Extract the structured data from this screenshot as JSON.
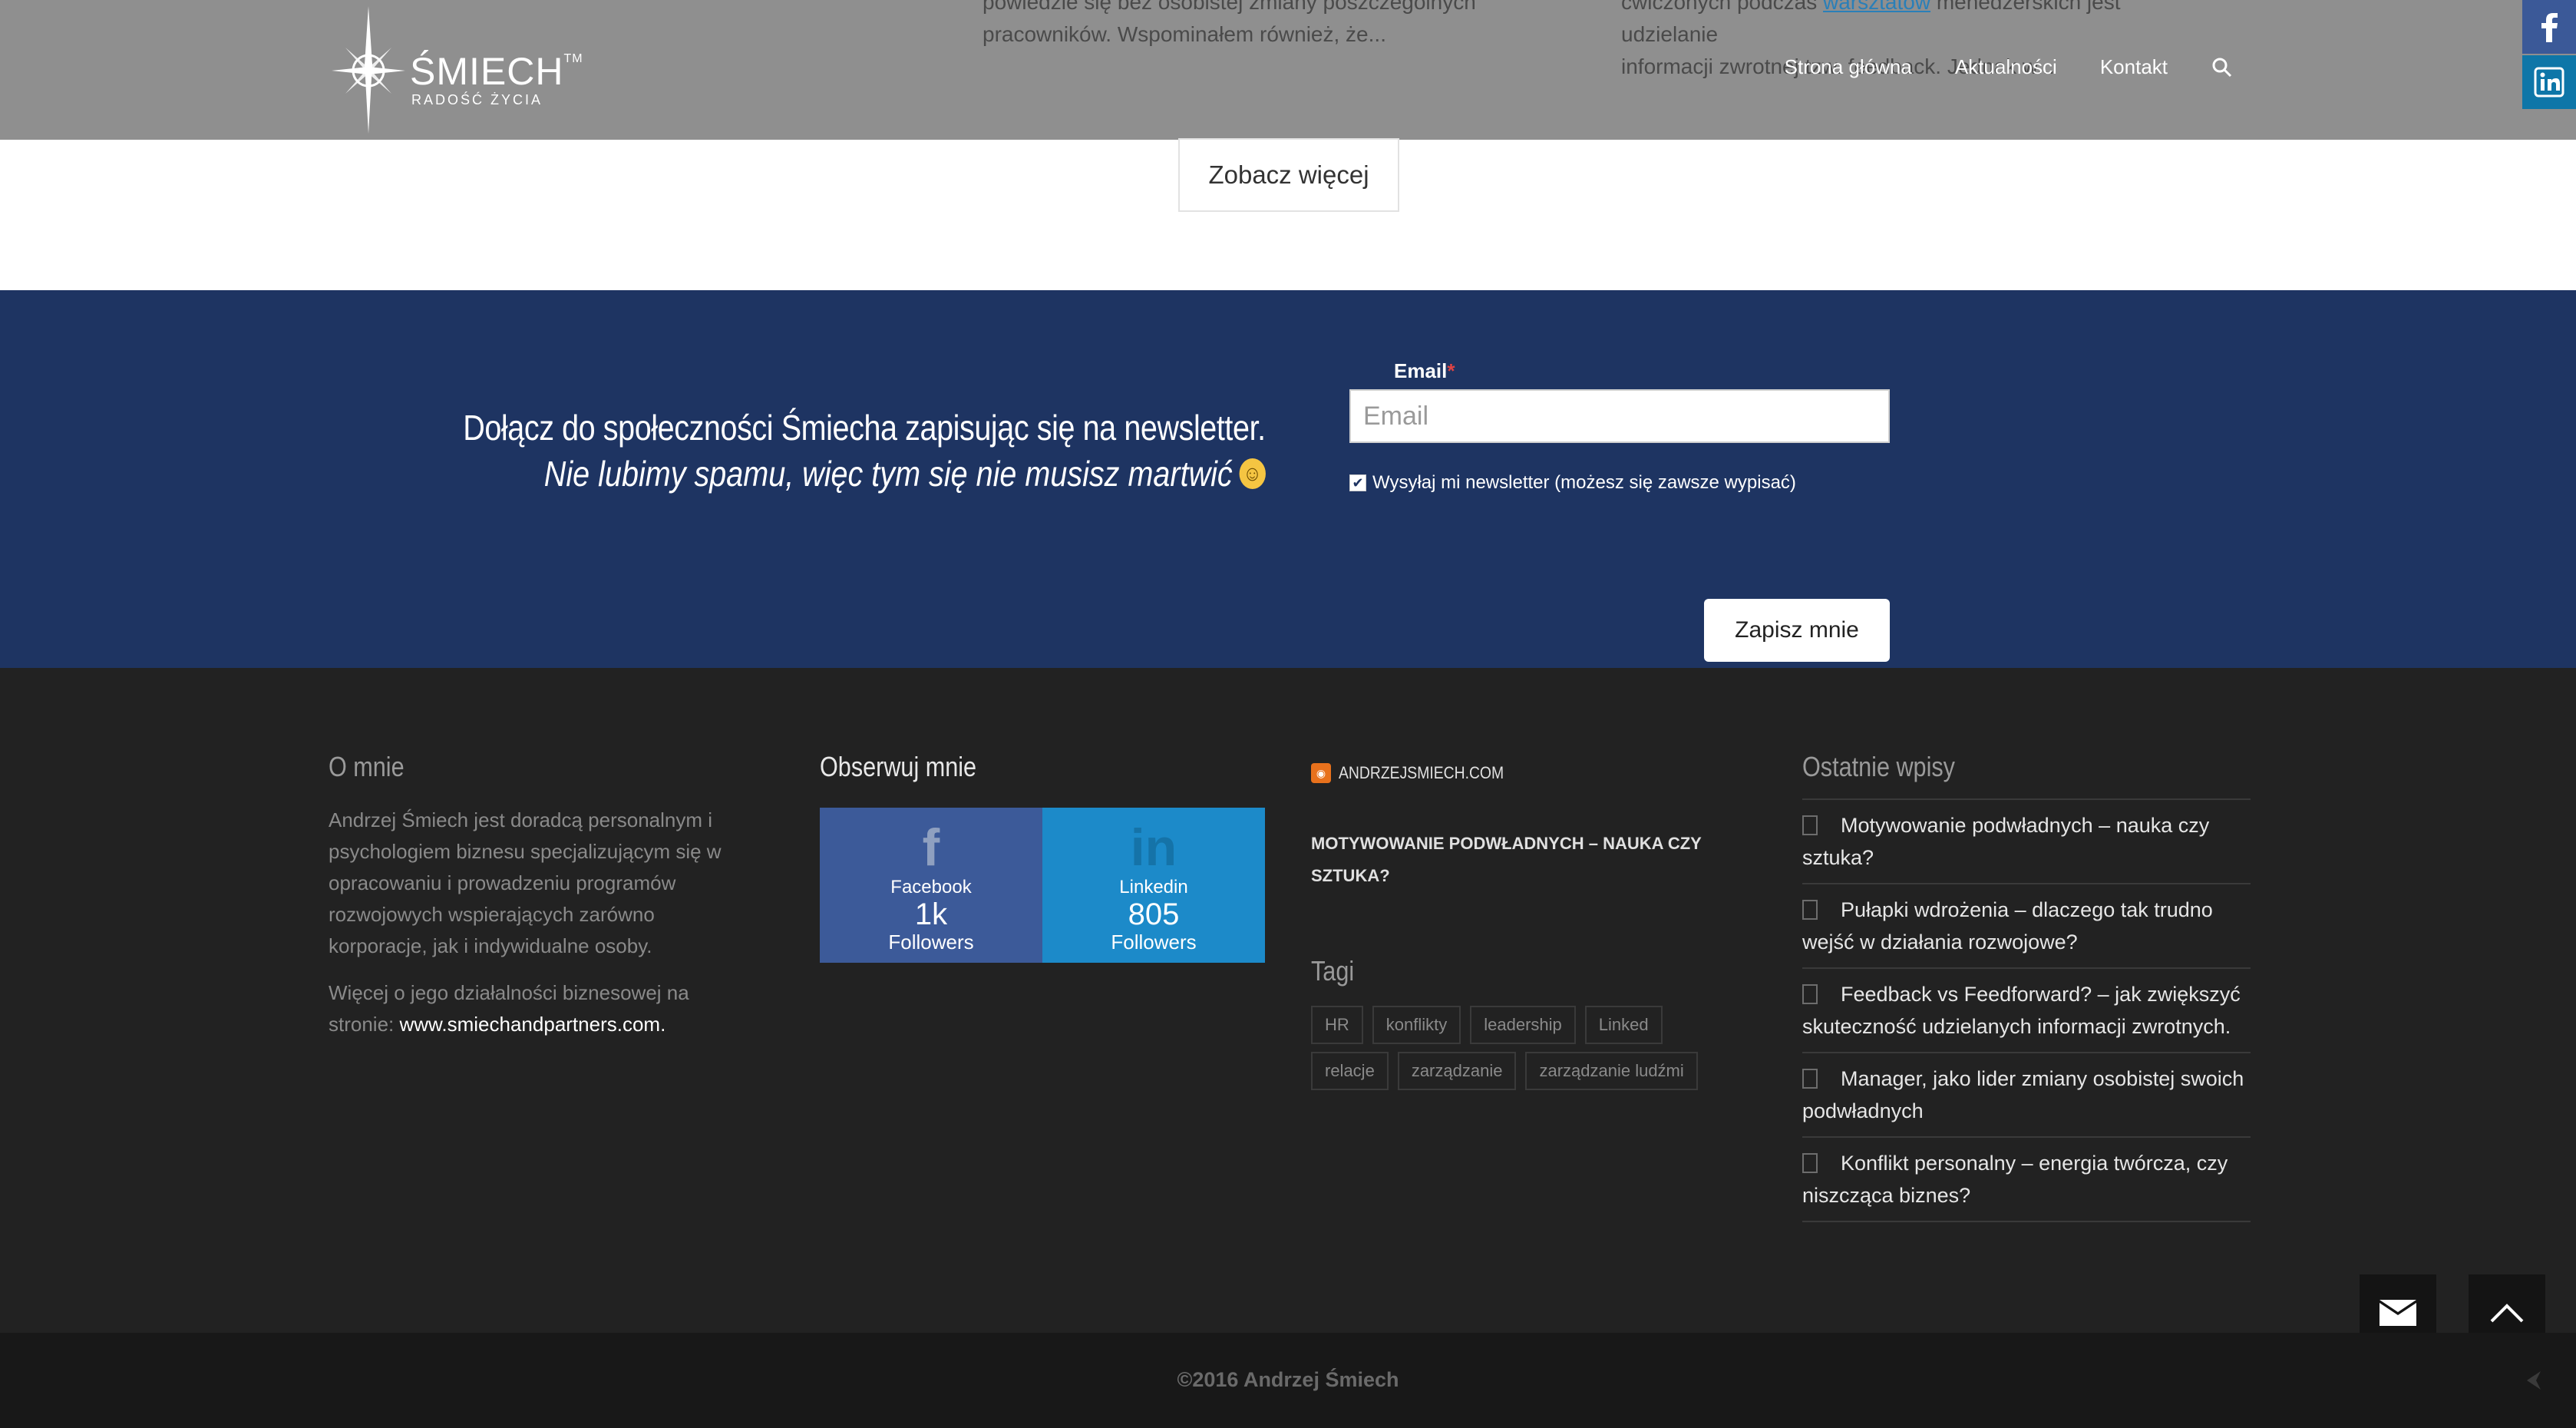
{
  "header": {
    "teaser_middle": [
      "powiedzie się bez osobistej zmiany poszczególnych",
      "pracowników. Wspominałem również, że..."
    ],
    "teaser_right_line1_a": "ćwiczonych podczas ",
    "teaser_right_line1_link": "warsztatów",
    "teaser_right_line1_b": " menedżerskich jest udzielanie",
    "teaser_right_line2": "informacji zwrotnej tzw. feedback. Jednak w...",
    "logo_name": "ŚMIECH",
    "logo_tm": "TM",
    "logo_tagline": "RADOŚĆ ŻYCIA",
    "nav": [
      "Strona główna",
      "Aktualności",
      "Kontakt"
    ],
    "search_icon": "search-icon"
  },
  "side_social": [
    "facebook-icon",
    "linkedin-icon"
  ],
  "more_button": "Zobacz więcej",
  "newsletter": {
    "line1": "Dołącz do społeczności Śmiecha zapisując się na newsletter.",
    "line2": "Nie lubimy spamu, więc tym się nie musisz martwić",
    "email_label": "Email",
    "required_mark": "*",
    "email_placeholder": "Email",
    "email_value": "",
    "consent_label": "Wysyłaj mi newsletter (możesz się zawsze wypisać)",
    "consent_checked": true,
    "submit": "Zapisz mnie"
  },
  "footer": {
    "about": {
      "title": "O mnie",
      "p1": "Andrzej Śmiech jest doradcą personalnym i psychologiem biznesu specjalizującym się w opracowaniu i prowadzeniu programów rozwojowych wspierających zarówno korporacje, jak i indywidualne osoby.",
      "p2_text": "Więcej o jego działalności biznesowej na stronie: ",
      "p2_link": "www.smiechandpartners.com."
    },
    "follow": {
      "title": "Obserwuj mnie",
      "facebook": {
        "icon": "f",
        "name": "Facebook",
        "count": "1k",
        "label": "Followers"
      },
      "linkedin": {
        "icon": "in",
        "name": "Linkedin",
        "count": "805",
        "label": "Followers"
      }
    },
    "rss": {
      "site": "ANDRZEJSMIECH.COM",
      "post": "MOTYWOWANIE PODWŁADNYCH – NAUKA CZY SZTUKA?"
    },
    "tags": {
      "title": "Tagi",
      "items": [
        "HR",
        "konflikty",
        "leadership",
        "Linked",
        "relacje",
        "zarządzanie",
        "zarządzanie ludźmi"
      ]
    },
    "recent": {
      "title": "Ostatnie wpisy",
      "items": [
        "Motywowanie podwładnych – nauka czy sztuka?",
        "Pułapki wdrożenia – dlaczego tak trudno wejść w działania rozwojowe?",
        "Feedback vs Feedforward? – jak zwiększyć skuteczność udzielanych informacji zwrotnych.",
        "Manager, jako lider zmiany osobistej swoich podwładnych",
        "Konflikt personalny – energia twórcza, czy niszcząca biznes?"
      ]
    },
    "copyright": "©2016 Andrzej Śmiech"
  },
  "floating": [
    "envelope-icon",
    "chevron-up-icon"
  ]
}
